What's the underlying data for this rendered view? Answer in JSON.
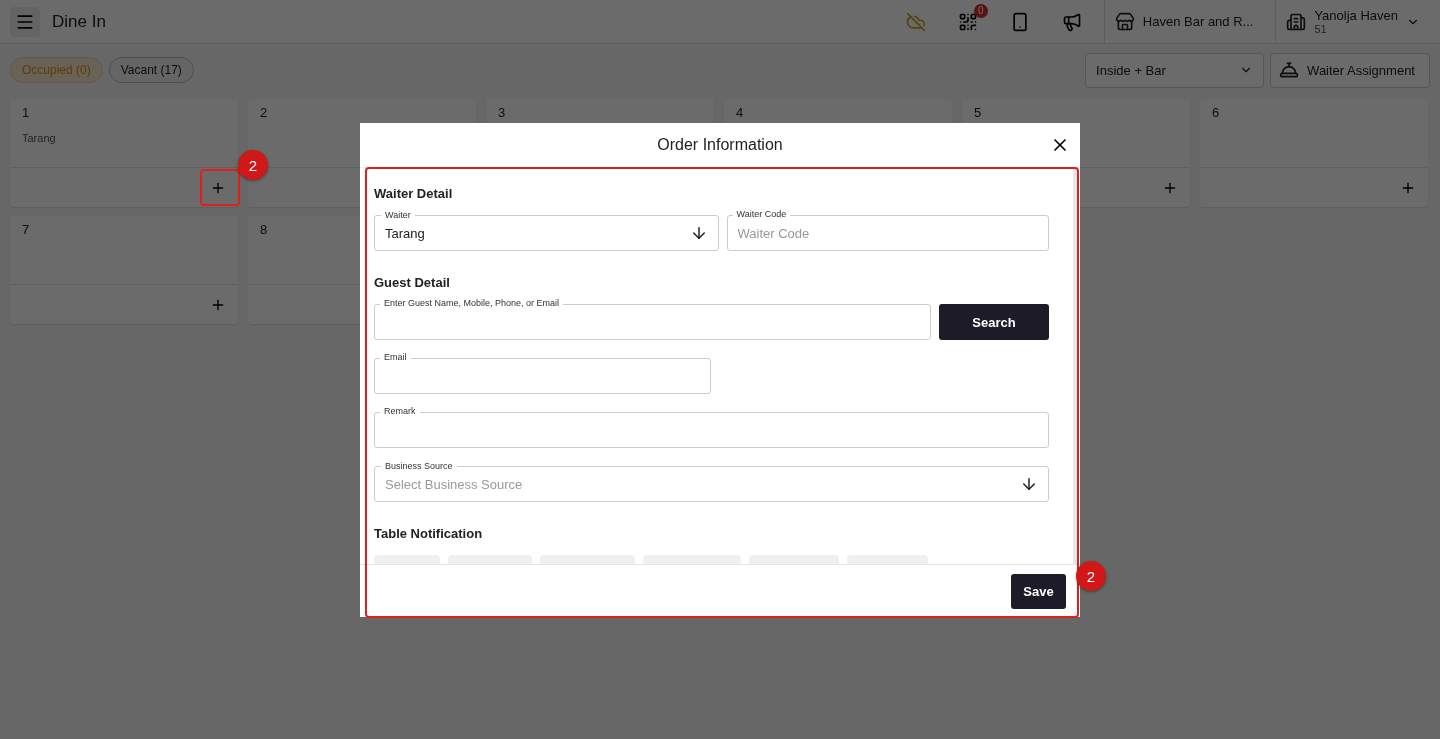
{
  "header": {
    "title": "Dine In",
    "notification_count": "0",
    "outlet": "Haven Bar and R...",
    "property": {
      "name": "Yanolja Haven",
      "code": "51"
    }
  },
  "filters": [
    {
      "label": "Occupied (0)",
      "kind": "occupied"
    },
    {
      "label": "Vacant (17)",
      "kind": "vacant"
    }
  ],
  "area_select": {
    "value": "Inside + Bar"
  },
  "waiter_assignment": {
    "label": "Waiter Assignment"
  },
  "tables": [
    {
      "number": "1",
      "waiter": "Tarang"
    },
    {
      "number": "2"
    },
    {
      "number": "3"
    },
    {
      "number": "4"
    },
    {
      "number": "5"
    },
    {
      "number": "6"
    },
    {
      "number": "7"
    },
    {
      "number": "8"
    }
  ],
  "modal": {
    "title": "Order Information",
    "sections": [
      {
        "title": "Waiter Detail"
      },
      {
        "title": "Guest Detail"
      },
      {
        "title": "Table Notification"
      }
    ],
    "waiter": {
      "label": "Waiter",
      "value": "Tarang"
    },
    "waiter_code": {
      "label": "Waiter Code",
      "placeholder": "Waiter Code"
    },
    "guest_search": {
      "label": "Enter Guest Name, Mobile, Phone, or Email"
    },
    "search_button": "Search",
    "email": {
      "label": "Email"
    },
    "remark": {
      "label": "Remark"
    },
    "business_source": {
      "label": "Business Source",
      "placeholder": "Select Business Source"
    },
    "save_button": "Save"
  },
  "annotations": [
    {
      "label": "2"
    },
    {
      "label": "2"
    }
  ]
}
